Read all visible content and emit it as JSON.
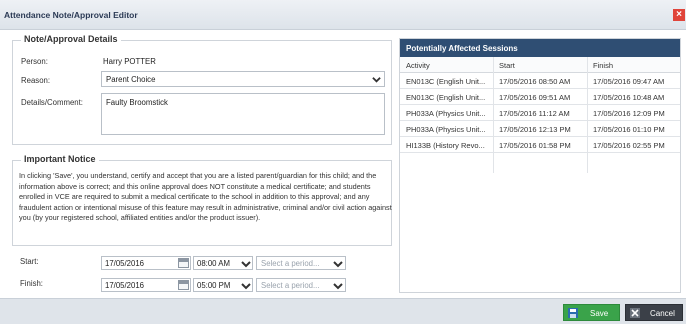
{
  "window": {
    "title": "Attendance Note/Approval Editor"
  },
  "details": {
    "legend": "Note/Approval Details",
    "person_label": "Person:",
    "person_value": "Harry POTTER",
    "reason_label": "Reason:",
    "reason_value": "Parent Choice",
    "comment_label": "Details/Comment:",
    "comment_value": "Faulty Broomstick"
  },
  "notice": {
    "legend": "Important Notice",
    "text": "In clicking 'Save', you understand, certify and accept that you are a listed parent/guardian for this child; and the information above is correct; and this online approval does NOT constitute a medical certificate; and students enrolled in VCE are required to submit a medical certificate to the school in addition to this approval; and any fraudulent action or intentional misuse of this feature may result in administrative, criminal and/or civil action against you (by your registered school, affiliated entities and/or the product issuer)."
  },
  "start": {
    "label": "Start:",
    "date": "17/05/2016",
    "time": "08:00 AM",
    "period_placeholder": "Select a period..."
  },
  "finish": {
    "label": "Finish:",
    "date": "17/05/2016",
    "time": "05:00 PM",
    "period_placeholder": "Select a period..."
  },
  "sessions": {
    "title": "Potentially Affected Sessions",
    "columns": [
      "Activity",
      "Start",
      "Finish"
    ],
    "rows": [
      [
        "EN013C (English Unit...",
        "17/05/2016 08:50 AM",
        "17/05/2016 09:47 AM"
      ],
      [
        "EN013C (English Unit...",
        "17/05/2016 09:51 AM",
        "17/05/2016 10:48 AM"
      ],
      [
        "PH033A (Physics Unit...",
        "17/05/2016 11:12 AM",
        "17/05/2016 12:09 PM"
      ],
      [
        "PH033A (Physics Unit...",
        "17/05/2016 12:13 PM",
        "17/05/2016 01:10 PM"
      ],
      [
        "HI133B (History Revo...",
        "17/05/2016 01:58 PM",
        "17/05/2016 02:55 PM"
      ]
    ]
  },
  "footer": {
    "save_label": "Save",
    "cancel_label": "Cancel"
  },
  "colors": {
    "header": "#2f4e73",
    "save": "#3aa34a",
    "cancel": "#3b4048",
    "close": "#e0443a"
  }
}
